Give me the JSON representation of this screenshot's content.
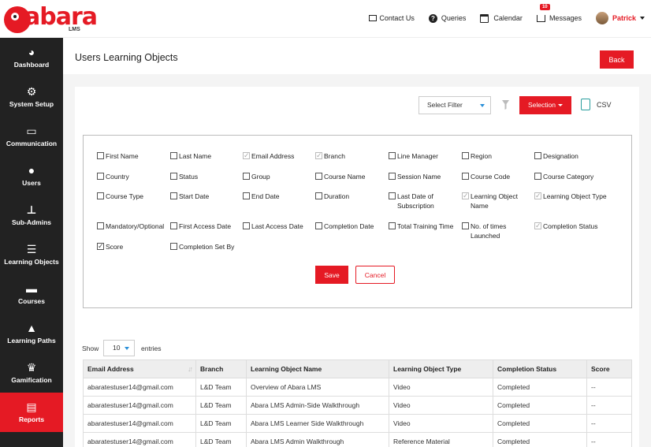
{
  "brand": {
    "name": "abara",
    "sub": "LMS",
    "color": "#e51a24"
  },
  "topnav": {
    "contact": "Contact Us",
    "queries": "Queries",
    "calendar": "Calendar",
    "messages": "Messages",
    "messages_badge": "10",
    "user": "Patrick"
  },
  "sidebar": {
    "items": [
      {
        "label": "Dashboard",
        "icon": "dashboard-icon"
      },
      {
        "label": "System Setup",
        "icon": "gear-icon"
      },
      {
        "label": "Communication",
        "icon": "inbox-icon"
      },
      {
        "label": "Users",
        "icon": "users-icon"
      },
      {
        "label": "Sub-Admins",
        "icon": "sitemap-icon"
      },
      {
        "label": "Learning Objects",
        "icon": "server-icon"
      },
      {
        "label": "Courses",
        "icon": "monitor-icon"
      },
      {
        "label": "Learning Paths",
        "icon": "road-icon"
      },
      {
        "label": "Gamification",
        "icon": "trophy-icon"
      },
      {
        "label": "Reports",
        "icon": "report-icon"
      }
    ],
    "active": "Reports"
  },
  "page": {
    "title": "Users Learning Objects",
    "back_label": "Back"
  },
  "filter": {
    "select_placeholder": "Select Filter",
    "selection_label": "Selection",
    "csv_label": "CSV"
  },
  "columns": [
    {
      "label": "First Name",
      "checked": false,
      "disabled": false
    },
    {
      "label": "Last Name",
      "checked": false,
      "disabled": false
    },
    {
      "label": "Email Address",
      "checked": true,
      "disabled": true
    },
    {
      "label": "Branch",
      "checked": true,
      "disabled": true
    },
    {
      "label": "Line Manager",
      "checked": false,
      "disabled": false
    },
    {
      "label": "Region",
      "checked": false,
      "disabled": false
    },
    {
      "label": "Designation",
      "checked": false,
      "disabled": false
    },
    {
      "label": "Country",
      "checked": false,
      "disabled": false
    },
    {
      "label": "Status",
      "checked": false,
      "disabled": false
    },
    {
      "label": "Group",
      "checked": false,
      "disabled": false
    },
    {
      "label": "Course Name",
      "checked": false,
      "disabled": false
    },
    {
      "label": "Session Name",
      "checked": false,
      "disabled": false
    },
    {
      "label": "Course Code",
      "checked": false,
      "disabled": false
    },
    {
      "label": "Course Category",
      "checked": false,
      "disabled": false
    },
    {
      "label": "Course Type",
      "checked": false,
      "disabled": false
    },
    {
      "label": "Start Date",
      "checked": false,
      "disabled": false
    },
    {
      "label": "End Date",
      "checked": false,
      "disabled": false
    },
    {
      "label": "Duration",
      "checked": false,
      "disabled": false
    },
    {
      "label": "Last Date of Subscription",
      "checked": false,
      "disabled": false
    },
    {
      "label": "Learning Object Name",
      "checked": true,
      "disabled": true
    },
    {
      "label": "Learning Object Type",
      "checked": true,
      "disabled": true
    },
    {
      "label": "Mandatory/Optional",
      "checked": false,
      "disabled": false
    },
    {
      "label": "First Access Date",
      "checked": false,
      "disabled": false
    },
    {
      "label": "Last Access Date",
      "checked": false,
      "disabled": false
    },
    {
      "label": "Completion Date",
      "checked": false,
      "disabled": false
    },
    {
      "label": "Total Training Time",
      "checked": false,
      "disabled": false
    },
    {
      "label": "No. of times Launched",
      "checked": false,
      "disabled": false
    },
    {
      "label": "Completion Status",
      "checked": true,
      "disabled": true
    },
    {
      "label": "Score",
      "checked": true,
      "disabled": false
    },
    {
      "label": "Completion Set By",
      "checked": false,
      "disabled": false
    }
  ],
  "actions": {
    "save": "Save",
    "cancel": "Cancel"
  },
  "table": {
    "show_label": "Show",
    "page_size": "10",
    "entries_label": "entries",
    "headers": [
      "Email Address",
      "Branch",
      "Learning Object Name",
      "Learning Object Type",
      "Completion Status",
      "Score"
    ],
    "rows": [
      [
        "abaratestuser14@gmail.com",
        "L&D Team",
        "Overview of Abara LMS",
        "Video",
        "Completed",
        "--"
      ],
      [
        "abaratestuser14@gmail.com",
        "L&D Team",
        "Abara LMS Admin-Side Walkthrough",
        "Video",
        "Completed",
        "--"
      ],
      [
        "abaratestuser14@gmail.com",
        "L&D Team",
        "Abara LMS Learner Side Walkthrough",
        "Video",
        "Completed",
        "--"
      ],
      [
        "abaratestuser14@gmail.com",
        "L&D Team",
        "Abara LMS Admin Walkthrough",
        "Reference Material",
        "Completed",
        "--"
      ]
    ]
  }
}
